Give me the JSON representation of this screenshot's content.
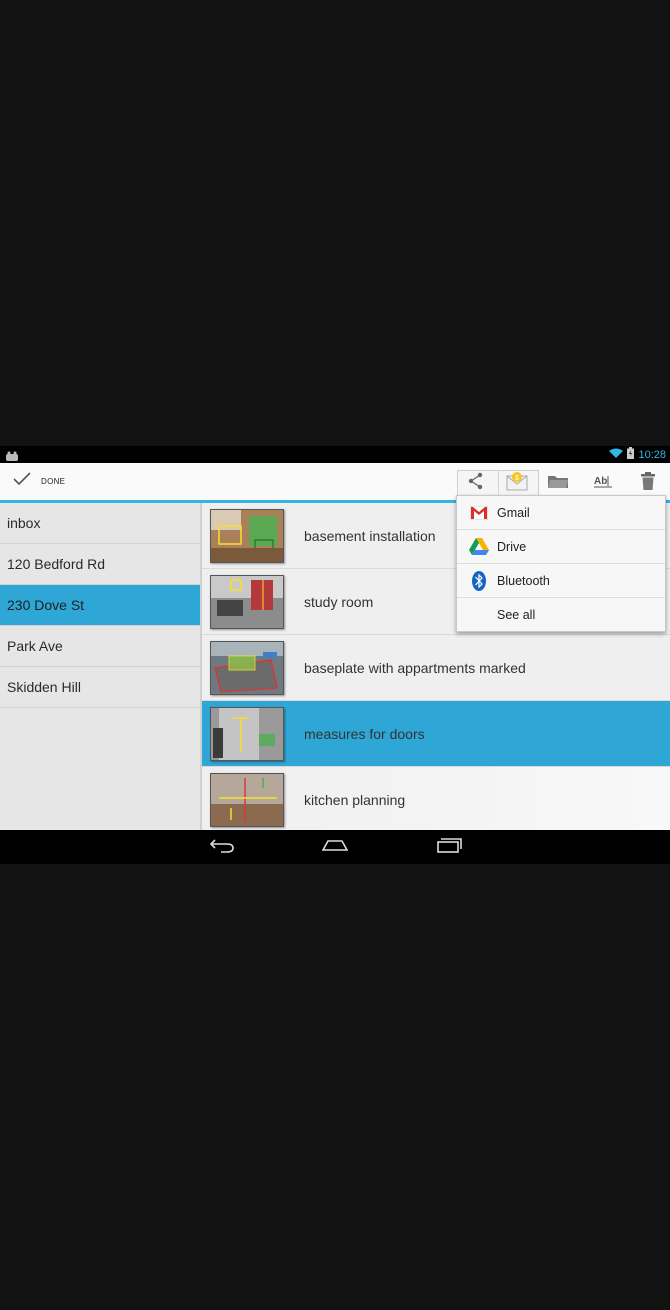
{
  "status_bar": {
    "time": "10:28"
  },
  "action_bar": {
    "done_label": "DONE",
    "icons": [
      "share-icon",
      "mail-icon",
      "folder-icon",
      "rename-icon",
      "trash-icon"
    ]
  },
  "folders": [
    {
      "label": "inbox",
      "selected": false
    },
    {
      "label": "120 Bedford Rd",
      "selected": false
    },
    {
      "label": "230 Dove St",
      "selected": true
    },
    {
      "label": "Park Ave",
      "selected": false
    },
    {
      "label": "Skidden Hill",
      "selected": false
    }
  ],
  "items": [
    {
      "label": "basement installation",
      "selected": false
    },
    {
      "label": "study room",
      "selected": false
    },
    {
      "label": "baseplate with appartments marked",
      "selected": false
    },
    {
      "label": "measures for doors",
      "selected": true
    },
    {
      "label": "kitchen planning",
      "selected": false
    }
  ],
  "share_menu": {
    "items": [
      {
        "label": "Gmail",
        "icon": "gmail-icon"
      },
      {
        "label": "Drive",
        "icon": "drive-icon"
      },
      {
        "label": "Bluetooth",
        "icon": "bluetooth-icon"
      },
      {
        "label": "See all",
        "icon": ""
      }
    ]
  },
  "colors": {
    "accent": "#33b5e5",
    "selection": "#2fa7d6"
  }
}
